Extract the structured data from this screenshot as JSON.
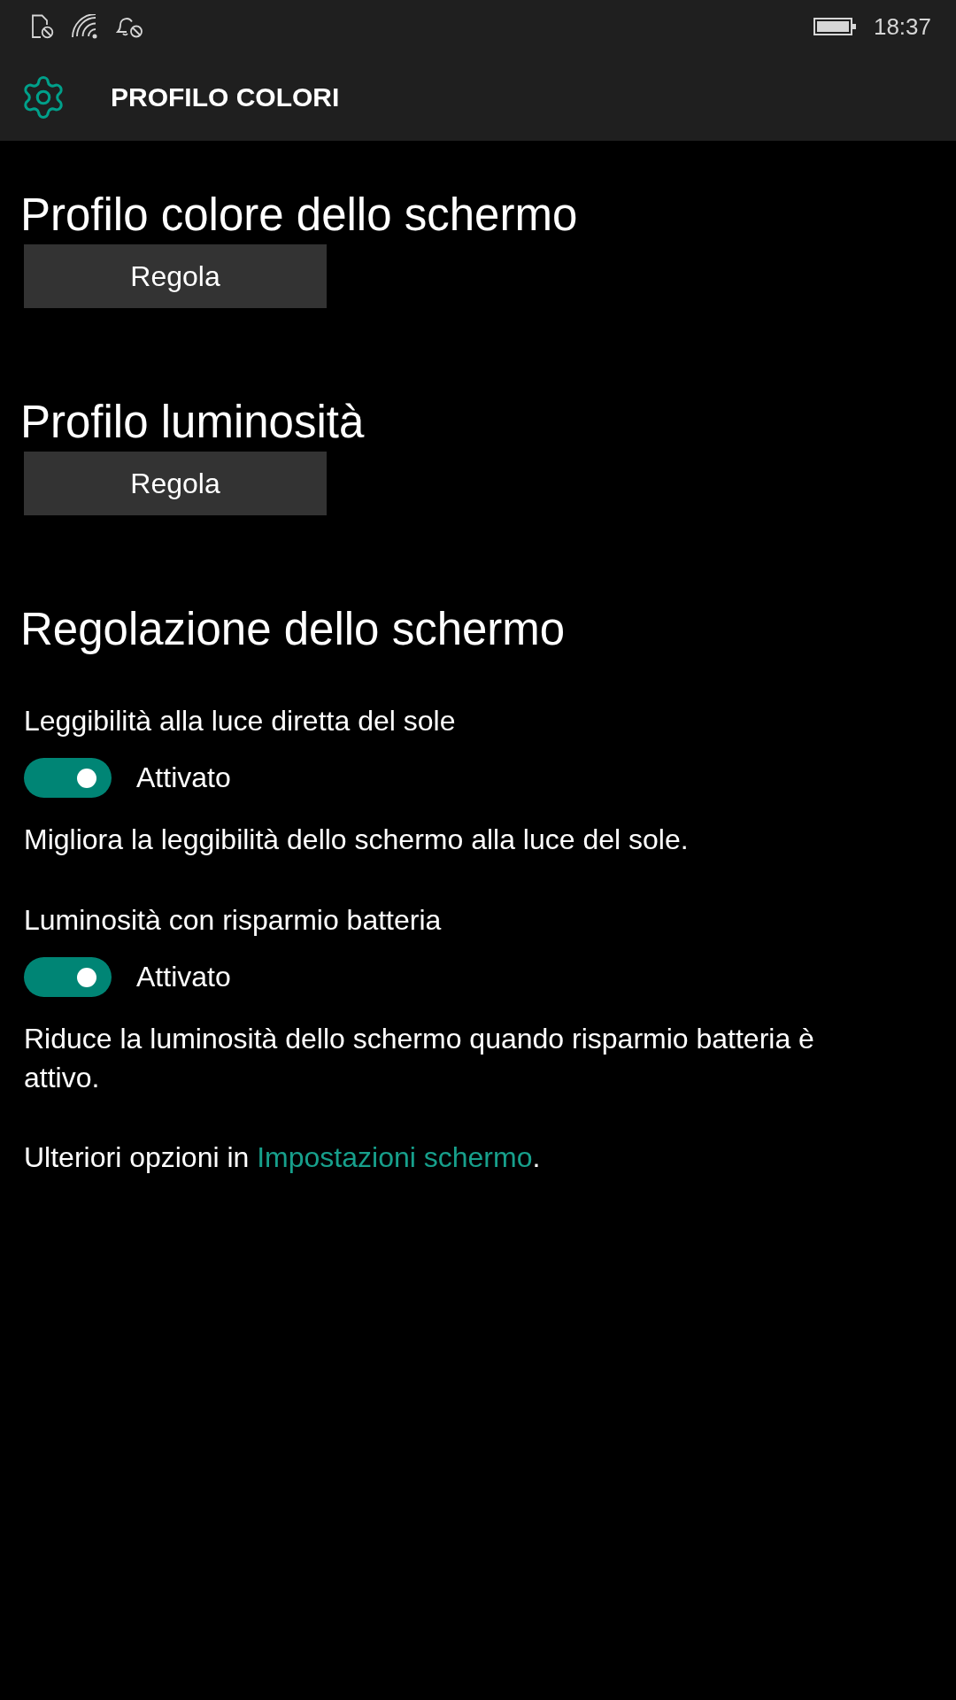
{
  "status_bar": {
    "time": "18:37"
  },
  "header": {
    "title": "PROFILO COLORI"
  },
  "sections": [
    {
      "kind": "button",
      "heading": "Profilo colore dello schermo",
      "button": "Regola"
    },
    {
      "kind": "button",
      "heading": "Profilo luminosità",
      "button": "Regola"
    },
    {
      "kind": "toggles",
      "heading": "Regolazione dello schermo",
      "settings": [
        {
          "label": "Leggibilità alla luce diretta del sole",
          "on": true,
          "state": "Attivato",
          "description": "Migliora la leggibilità dello schermo alla luce del sole."
        },
        {
          "label": "Luminosità con risparmio batteria",
          "on": true,
          "state": "Attivato",
          "description": "Riduce la luminosità dello schermo quando risparmio batteria è attivo."
        }
      ],
      "footer": {
        "text": "Ulteriori opzioni in",
        "link": "Impostazioni schermo",
        "end": "."
      }
    }
  ]
}
